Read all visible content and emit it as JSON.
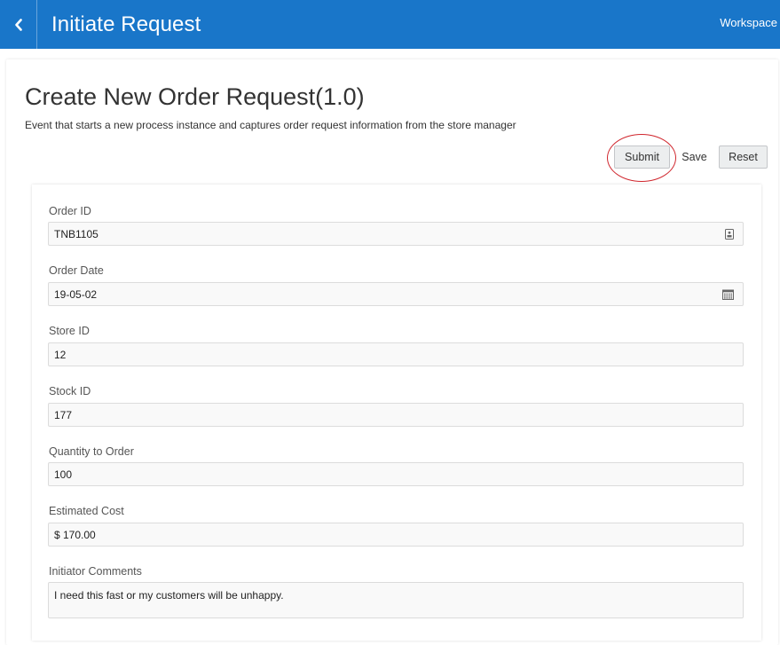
{
  "header": {
    "title": "Initiate Request",
    "workspace_link": "Workspace",
    "back_icon": "chevron-left-icon",
    "background_color": "#1976c9"
  },
  "page": {
    "title": "Create New Order Request(1.0)",
    "description": "Event that starts a new process instance and captures order request information from the store manager"
  },
  "actions": {
    "submit_label": "Submit",
    "save_label": "Save",
    "reset_label": "Reset",
    "highlight_color": "#d0262d"
  },
  "form": {
    "fields": [
      {
        "label": "Order ID",
        "value": "TNB1105",
        "icon": "id-badge-icon"
      },
      {
        "label": "Order Date",
        "value": "19-05-02",
        "icon": "calendar-icon"
      },
      {
        "label": "Store ID",
        "value": "12"
      },
      {
        "label": "Stock ID",
        "value": "177"
      },
      {
        "label": "Quantity to Order",
        "value": "100"
      },
      {
        "label": "Estimated Cost",
        "value": "$ 170.00"
      },
      {
        "label": "Initiator Comments",
        "value": "I need this fast or my customers will be unhappy."
      }
    ]
  }
}
